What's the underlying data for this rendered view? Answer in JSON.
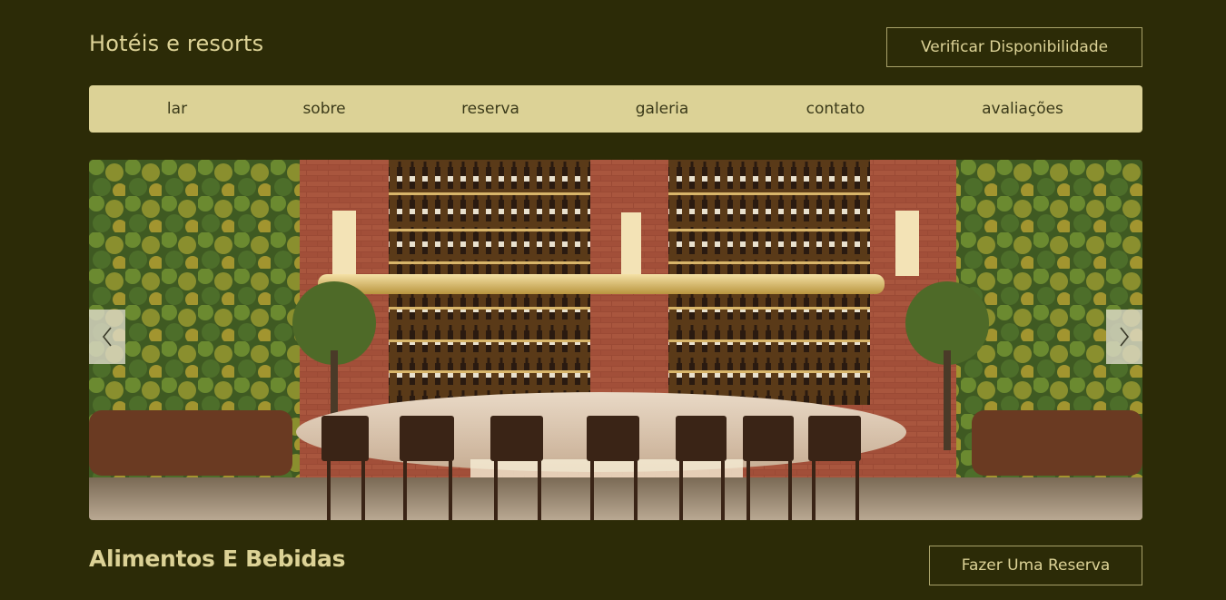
{
  "header": {
    "title": "Hotéis e resorts",
    "cta_label": "Verificar Disponibilidade"
  },
  "nav": {
    "items": [
      {
        "label": "lar"
      },
      {
        "label": "sobre"
      },
      {
        "label": "reserva"
      },
      {
        "label": "galeria"
      },
      {
        "label": "contato"
      },
      {
        "label": "avaliações"
      }
    ]
  },
  "carousel": {
    "prev_icon": "chevron-left-icon",
    "next_icon": "chevron-right-icon"
  },
  "section": {
    "title": "Alimentos E Bebidas",
    "cta_label": "Fazer Uma Reserva"
  },
  "colors": {
    "background": "#2c2b07",
    "accent": "#dcd296",
    "nav_text": "#3b3a1a",
    "border": "#a9a26a"
  }
}
